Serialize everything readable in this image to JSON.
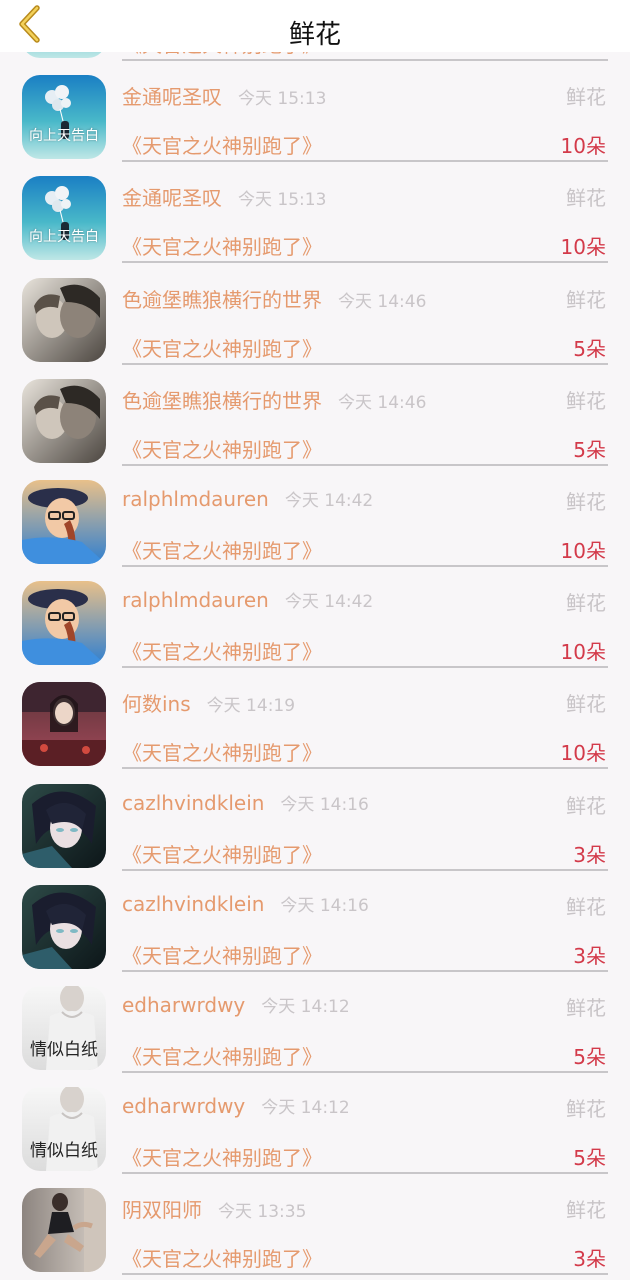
{
  "header": {
    "title": "鲜花"
  },
  "rows": [
    {
      "name": "",
      "time": "",
      "type": "",
      "book": "《天官之火神别跑了》",
      "count": "",
      "avatar": "balloon",
      "caption": ""
    },
    {
      "name": "金通呢圣叹",
      "time": "今天 15:13",
      "type": "鲜花",
      "book": "《天官之火神别跑了》",
      "count": "10朵",
      "avatar": "balloon",
      "caption": "向上天告白"
    },
    {
      "name": "金通呢圣叹",
      "time": "今天 15:13",
      "type": "鲜花",
      "book": "《天官之火神别跑了》",
      "count": "10朵",
      "avatar": "balloon",
      "caption": "向上天告白"
    },
    {
      "name": "色逾堡瞧狼横行的世界",
      "time": "今天 14:46",
      "type": "鲜花",
      "book": "《天官之火神别跑了》",
      "count": "5朵",
      "avatar": "couple",
      "caption": ""
    },
    {
      "name": "色逾堡瞧狼横行的世界",
      "time": "今天 14:46",
      "type": "鲜花",
      "book": "《天官之火神别跑了》",
      "count": "5朵",
      "avatar": "couple",
      "caption": ""
    },
    {
      "name": "ralphlmdauren",
      "time": "今天 14:42",
      "type": "鲜花",
      "book": "《天官之火神别跑了》",
      "count": "10朵",
      "avatar": "girl",
      "caption": ""
    },
    {
      "name": "ralphlmdauren",
      "time": "今天 14:42",
      "type": "鲜花",
      "book": "《天官之火神别跑了》",
      "count": "10朵",
      "avatar": "girl",
      "caption": ""
    },
    {
      "name": "何数ins",
      "time": "今天 14:19",
      "type": "鲜花",
      "book": "《天官之火神别跑了》",
      "count": "10朵",
      "avatar": "painting",
      "caption": ""
    },
    {
      "name": "cazlhvindklein",
      "time": "今天 14:16",
      "type": "鲜花",
      "book": "《天官之火神别跑了》",
      "count": "3朵",
      "avatar": "anime",
      "caption": ""
    },
    {
      "name": "cazlhvindklein",
      "time": "今天 14:16",
      "type": "鲜花",
      "book": "《天官之火神别跑了》",
      "count": "3朵",
      "avatar": "anime",
      "caption": ""
    },
    {
      "name": "edharwrdwy",
      "time": "今天 14:12",
      "type": "鲜花",
      "book": "《天官之火神别跑了》",
      "count": "5朵",
      "avatar": "white",
      "caption": "情似白纸"
    },
    {
      "name": "edharwrdwy",
      "time": "今天 14:12",
      "type": "鲜花",
      "book": "《天官之火神别跑了》",
      "count": "5朵",
      "avatar": "white",
      "caption": "情似白纸"
    },
    {
      "name": "阴双阳师",
      "time": "今天 13:35",
      "type": "鲜花",
      "book": "《天官之火神别跑了》",
      "count": "3朵",
      "avatar": "runner",
      "caption": ""
    }
  ]
}
